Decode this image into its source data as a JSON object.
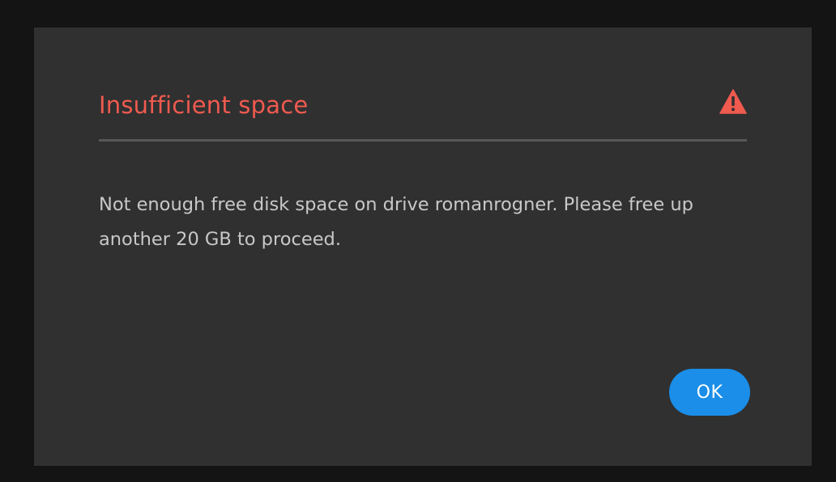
{
  "dialog": {
    "title": "Insufficient space",
    "icon": "warning-triangle-icon",
    "message_line1": "Not enough free disk space on drive romanrogner. Please free up",
    "message_line2": "another 20 GB to proceed.",
    "ok_label": "OK"
  },
  "colors": {
    "background": "#141414",
    "dialog": "#303030",
    "title": "#f05a4f",
    "icon": "#f05a4f",
    "divider": "#575757",
    "text": "#c8c8c8",
    "button": "#1a8ee8"
  }
}
